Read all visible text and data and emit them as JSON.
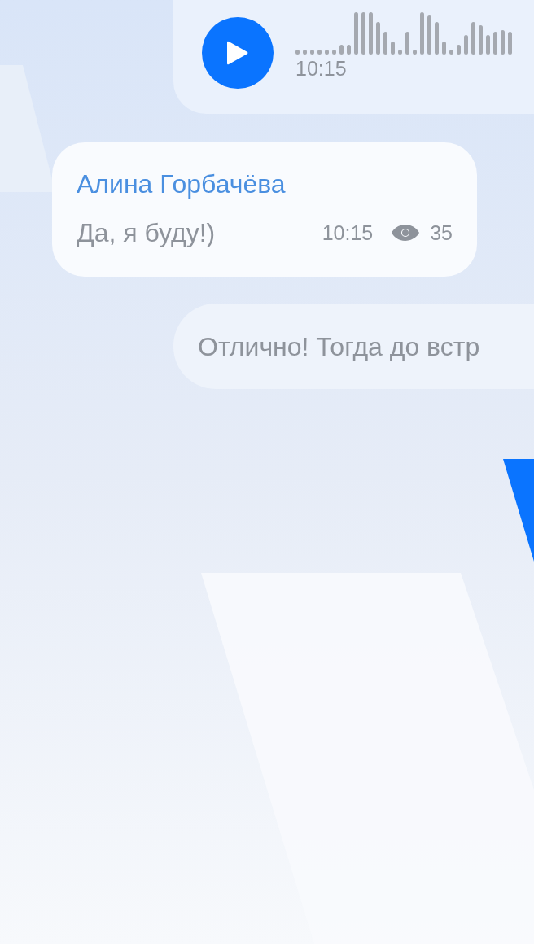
{
  "messages": [
    {
      "kind": "voice",
      "time": "10:15"
    },
    {
      "kind": "text",
      "sender": "Алина Горбачёва",
      "text": "Да, я буду!)",
      "time": "10:15",
      "views": "35"
    },
    {
      "kind": "outgoing",
      "text": "Отлично! Тогда до встр"
    }
  ]
}
